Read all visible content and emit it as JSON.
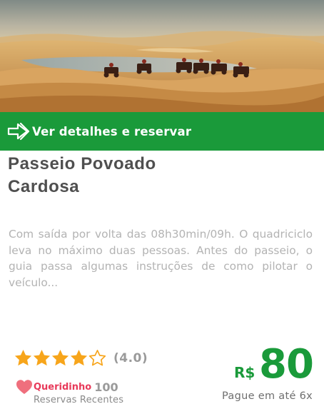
{
  "hero": {
    "image": "desert-dunes-quad-bikes-photo"
  },
  "cta": {
    "label": "Ver detalhes e reservar",
    "icon": "double-arrow-right-icon"
  },
  "tour": {
    "title_line1": "Passeio Povoado",
    "title_line2": "Cardosa",
    "description": "Com saída por volta das 08h30min/09h. O quad­riciclo leva no máximo duas pessoas. Antes do passeio, o guia passa algumas instruções de como pilotar o veículo..."
  },
  "rating": {
    "value": 4.0,
    "max": 5,
    "display": "(4.0)",
    "star_color": "#f7a51b"
  },
  "favorite": {
    "label": "Queridinho",
    "count": "100",
    "subtitle": "Reservas Recentes",
    "heart_color": "#ef6f7d"
  },
  "price": {
    "currency": "R$",
    "amount": "80",
    "installments": "Pague em até 6x"
  },
  "colors": {
    "accent": "#1a9a3a",
    "title": "#4f4f4f",
    "description": "#b3b3b3"
  }
}
